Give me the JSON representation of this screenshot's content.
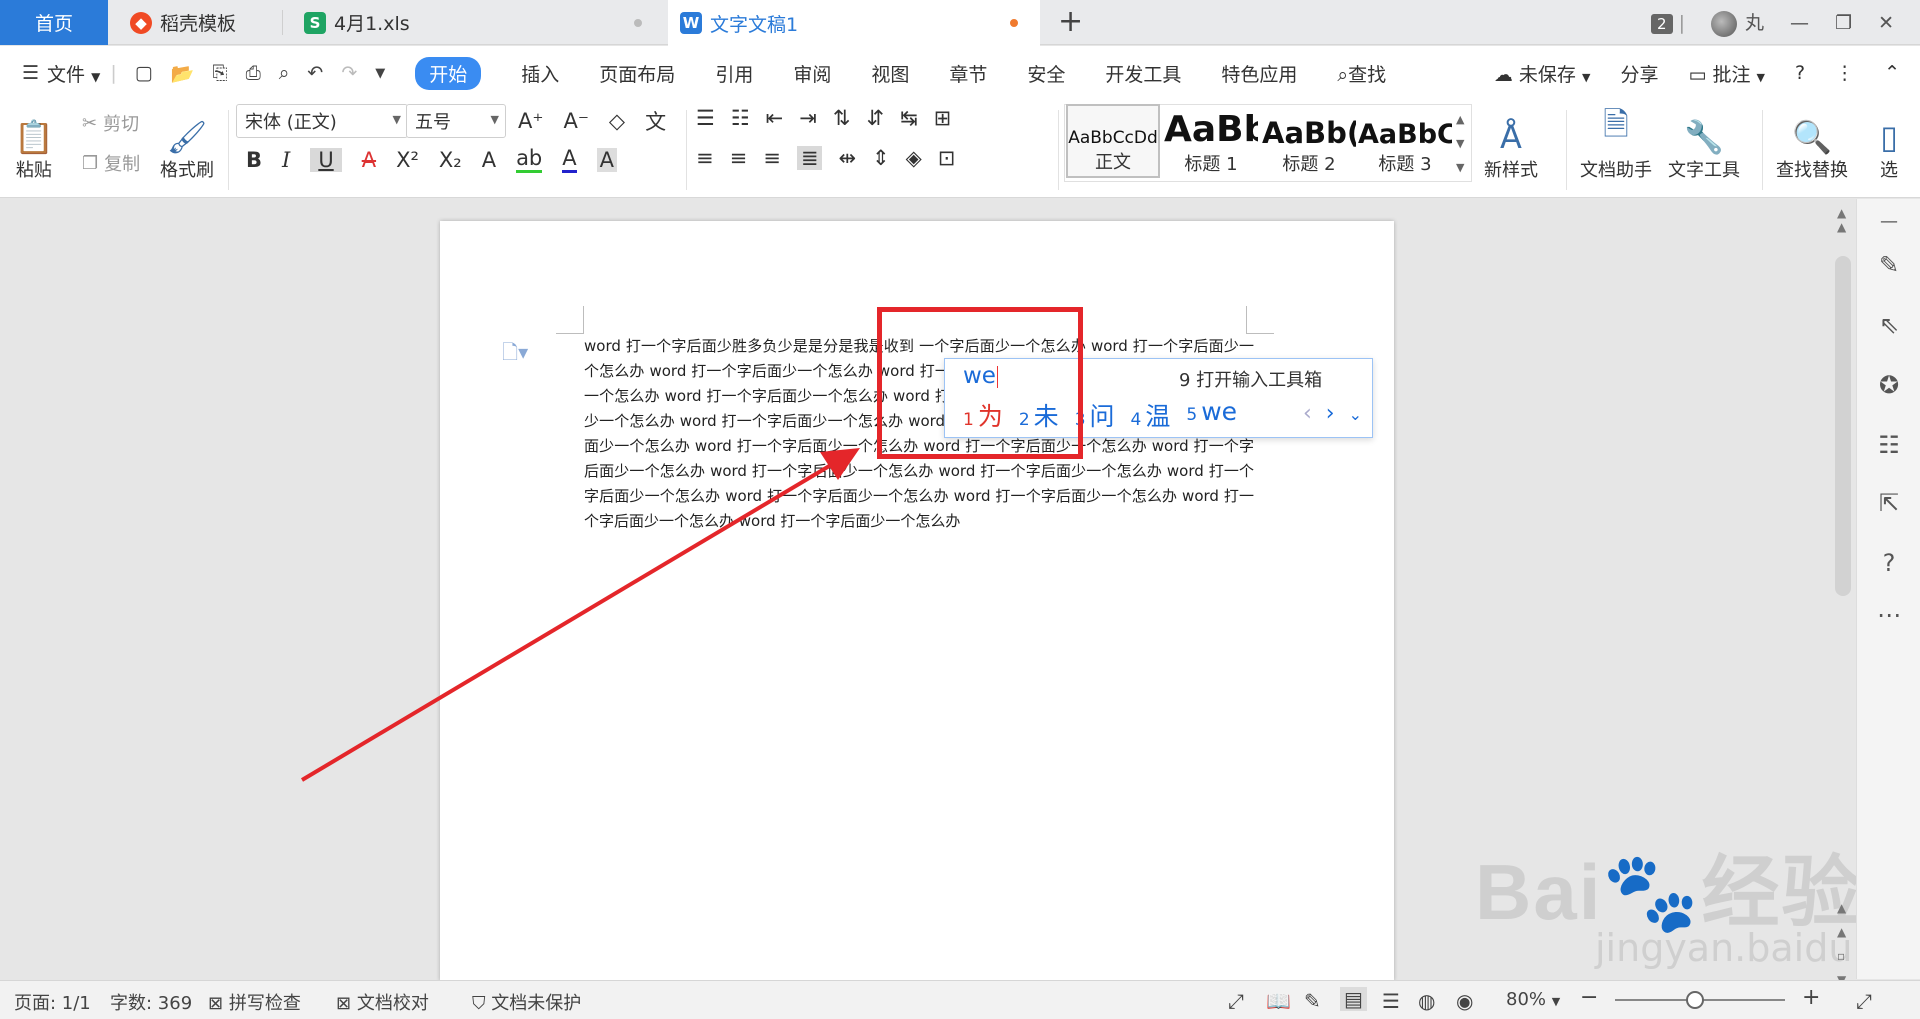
{
  "tabs": {
    "home": "首页",
    "daoke": "稻壳模板",
    "xls": "4月1.xls",
    "doc": "文字文稿1"
  },
  "titlebar": {
    "badge": "2",
    "user": "丸"
  },
  "menu": {
    "file": "文件",
    "items": [
      "开始",
      "插入",
      "页面布局",
      "引用",
      "审阅",
      "视图",
      "章节",
      "安全",
      "开发工具",
      "特色应用"
    ],
    "search": "查找",
    "unsaved": "未保存",
    "share": "分享",
    "comment": "批注"
  },
  "ribbon": {
    "paste": "粘贴",
    "cut": "剪切",
    "copy": "复制",
    "format_painter": "格式刷",
    "font": "宋体 (正文)",
    "size": "五号",
    "styles": [
      {
        "preview": "AaBbCcDd",
        "label": "正文"
      },
      {
        "preview": "AaBb",
        "label": "标题 1"
      },
      {
        "preview": "AaBb(",
        "label": "标题 2"
      },
      {
        "preview": "AaBbC",
        "label": "标题 3"
      }
    ],
    "new_style": "新样式",
    "doc_helper": "文档助手",
    "text_tools": "文字工具",
    "find_replace": "查找替换",
    "select": "选"
  },
  "document": {
    "text": "word 打一个字后面少胜多负少是是分是我是收到 一个字后面少一个怎么办 word 打一个字后面少一个怎么办 word 打一个字后面少一个怎么办 word 打一个字后面少一个怎么办 word 打一个字后面少一个怎么办 word 打一个字后面少一个怎么办 word 打一个字后面少一个怎么办 word 打一个字后面少一个怎么办 word 打一个字后面少一个怎么办 word 打一个字后面少一个怎么办 word 打一个字后面少一个怎么办 word 打一个字后面少一个怎么办 word 打一个字后面少一个怎么办 word 打一个字后面少一个怎么办 word 打一个字后面少一个怎么办 word 打一个字后面少一个怎么办 word 打一个字后面少一个怎么办 word 打一个字后面少一个怎么办 word 打一个字后面少一个怎么办 word 打一个字后面少一个怎么办 word 打一个字后面少一个怎么办"
  },
  "ime": {
    "input": "we",
    "toolbox": "9 打开输入工具箱",
    "candidates": [
      {
        "num": "1",
        "text": "为"
      },
      {
        "num": "2",
        "text": "未"
      },
      {
        "num": "3",
        "text": "问"
      },
      {
        "num": "4",
        "text": "温"
      },
      {
        "num": "5",
        "text": "we"
      }
    ]
  },
  "status": {
    "page": "页面: 1/1",
    "words": "字数: 369",
    "spell": "拼写检查",
    "proof": "文档校对",
    "protect": "文档未保护",
    "zoom": "80%"
  },
  "watermark": {
    "brand": "Bai",
    "jingyan": "经验",
    "url": "jingyan.baidu.com"
  },
  "colors": {
    "accent": "#2b7bd9",
    "highlight_box": "#e4262a",
    "arrow": "#e4262a",
    "xls_icon": "#1fa463",
    "doc_icon": "#2b7bd9",
    "daoke_icon": "#f04a24"
  }
}
